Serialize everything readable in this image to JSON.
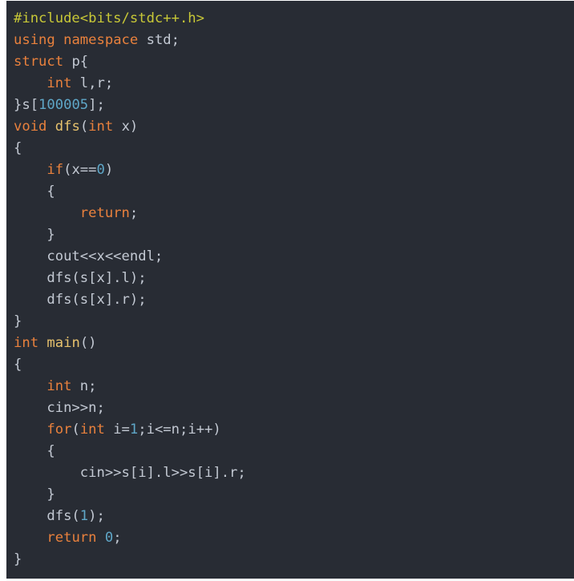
{
  "code": {
    "language": "cpp",
    "lines": [
      [
        {
          "t": "#include<bits/stdc++.h>",
          "c": "pp"
        }
      ],
      [
        {
          "t": "using",
          "c": "kw"
        },
        {
          "t": " ",
          "c": "txt"
        },
        {
          "t": "namespace",
          "c": "kw"
        },
        {
          "t": " std;",
          "c": "txt"
        }
      ],
      [
        {
          "t": "struct",
          "c": "kw"
        },
        {
          "t": " p{",
          "c": "txt"
        }
      ],
      [
        {
          "t": "    ",
          "c": "txt"
        },
        {
          "t": "int",
          "c": "type"
        },
        {
          "t": " l,r;",
          "c": "txt"
        }
      ],
      [
        {
          "t": "}s[",
          "c": "txt"
        },
        {
          "t": "100005",
          "c": "num"
        },
        {
          "t": "];",
          "c": "txt"
        }
      ],
      [
        {
          "t": "void",
          "c": "type"
        },
        {
          "t": " ",
          "c": "txt"
        },
        {
          "t": "dfs",
          "c": "fn"
        },
        {
          "t": "(",
          "c": "punc"
        },
        {
          "t": "int",
          "c": "type"
        },
        {
          "t": " x)",
          "c": "txt"
        }
      ],
      [
        {
          "t": "{",
          "c": "punc"
        }
      ],
      [
        {
          "t": "    ",
          "c": "txt"
        },
        {
          "t": "if",
          "c": "kw"
        },
        {
          "t": "(x==",
          "c": "txt"
        },
        {
          "t": "0",
          "c": "num"
        },
        {
          "t": ")",
          "c": "punc"
        }
      ],
      [
        {
          "t": "    {",
          "c": "punc"
        }
      ],
      [
        {
          "t": "        ",
          "c": "txt"
        },
        {
          "t": "return",
          "c": "kw"
        },
        {
          "t": ";",
          "c": "txt"
        }
      ],
      [
        {
          "t": "    }",
          "c": "punc"
        }
      ],
      [
        {
          "t": "    cout<<x<<endl;",
          "c": "txt"
        }
      ],
      [
        {
          "t": "    dfs(s[x].l);",
          "c": "txt"
        }
      ],
      [
        {
          "t": "    dfs(s[x].r);",
          "c": "txt"
        }
      ],
      [
        {
          "t": "}",
          "c": "punc"
        }
      ],
      [
        {
          "t": "int",
          "c": "type"
        },
        {
          "t": " ",
          "c": "txt"
        },
        {
          "t": "main",
          "c": "fn"
        },
        {
          "t": "()",
          "c": "punc"
        }
      ],
      [
        {
          "t": "{",
          "c": "punc"
        }
      ],
      [
        {
          "t": "    ",
          "c": "txt"
        },
        {
          "t": "int",
          "c": "type"
        },
        {
          "t": " n;",
          "c": "txt"
        }
      ],
      [
        {
          "t": "    cin>>n;",
          "c": "txt"
        }
      ],
      [
        {
          "t": "    ",
          "c": "txt"
        },
        {
          "t": "for",
          "c": "kw"
        },
        {
          "t": "(",
          "c": "punc"
        },
        {
          "t": "int",
          "c": "type"
        },
        {
          "t": " i=",
          "c": "txt"
        },
        {
          "t": "1",
          "c": "num"
        },
        {
          "t": ";i<=n;i++)",
          "c": "txt"
        }
      ],
      [
        {
          "t": "    {",
          "c": "punc"
        }
      ],
      [
        {
          "t": "        cin>>s[i].l>>s[i].r;",
          "c": "txt"
        }
      ],
      [
        {
          "t": "    }",
          "c": "punc"
        }
      ],
      [
        {
          "t": "    dfs(",
          "c": "txt"
        },
        {
          "t": "1",
          "c": "num"
        },
        {
          "t": ");",
          "c": "txt"
        }
      ],
      [
        {
          "t": "    ",
          "c": "txt"
        },
        {
          "t": "return",
          "c": "kw"
        },
        {
          "t": " ",
          "c": "txt"
        },
        {
          "t": "0",
          "c": "num"
        },
        {
          "t": ";",
          "c": "txt"
        }
      ],
      [
        {
          "t": "}",
          "c": "punc"
        }
      ]
    ]
  },
  "colors": {
    "background": "#282c34",
    "preprocessor": "#c8c837",
    "keyword": "#e9813d",
    "function": "#e7c26d",
    "number": "#5fa7c8",
    "text": "#c3c9d3"
  }
}
